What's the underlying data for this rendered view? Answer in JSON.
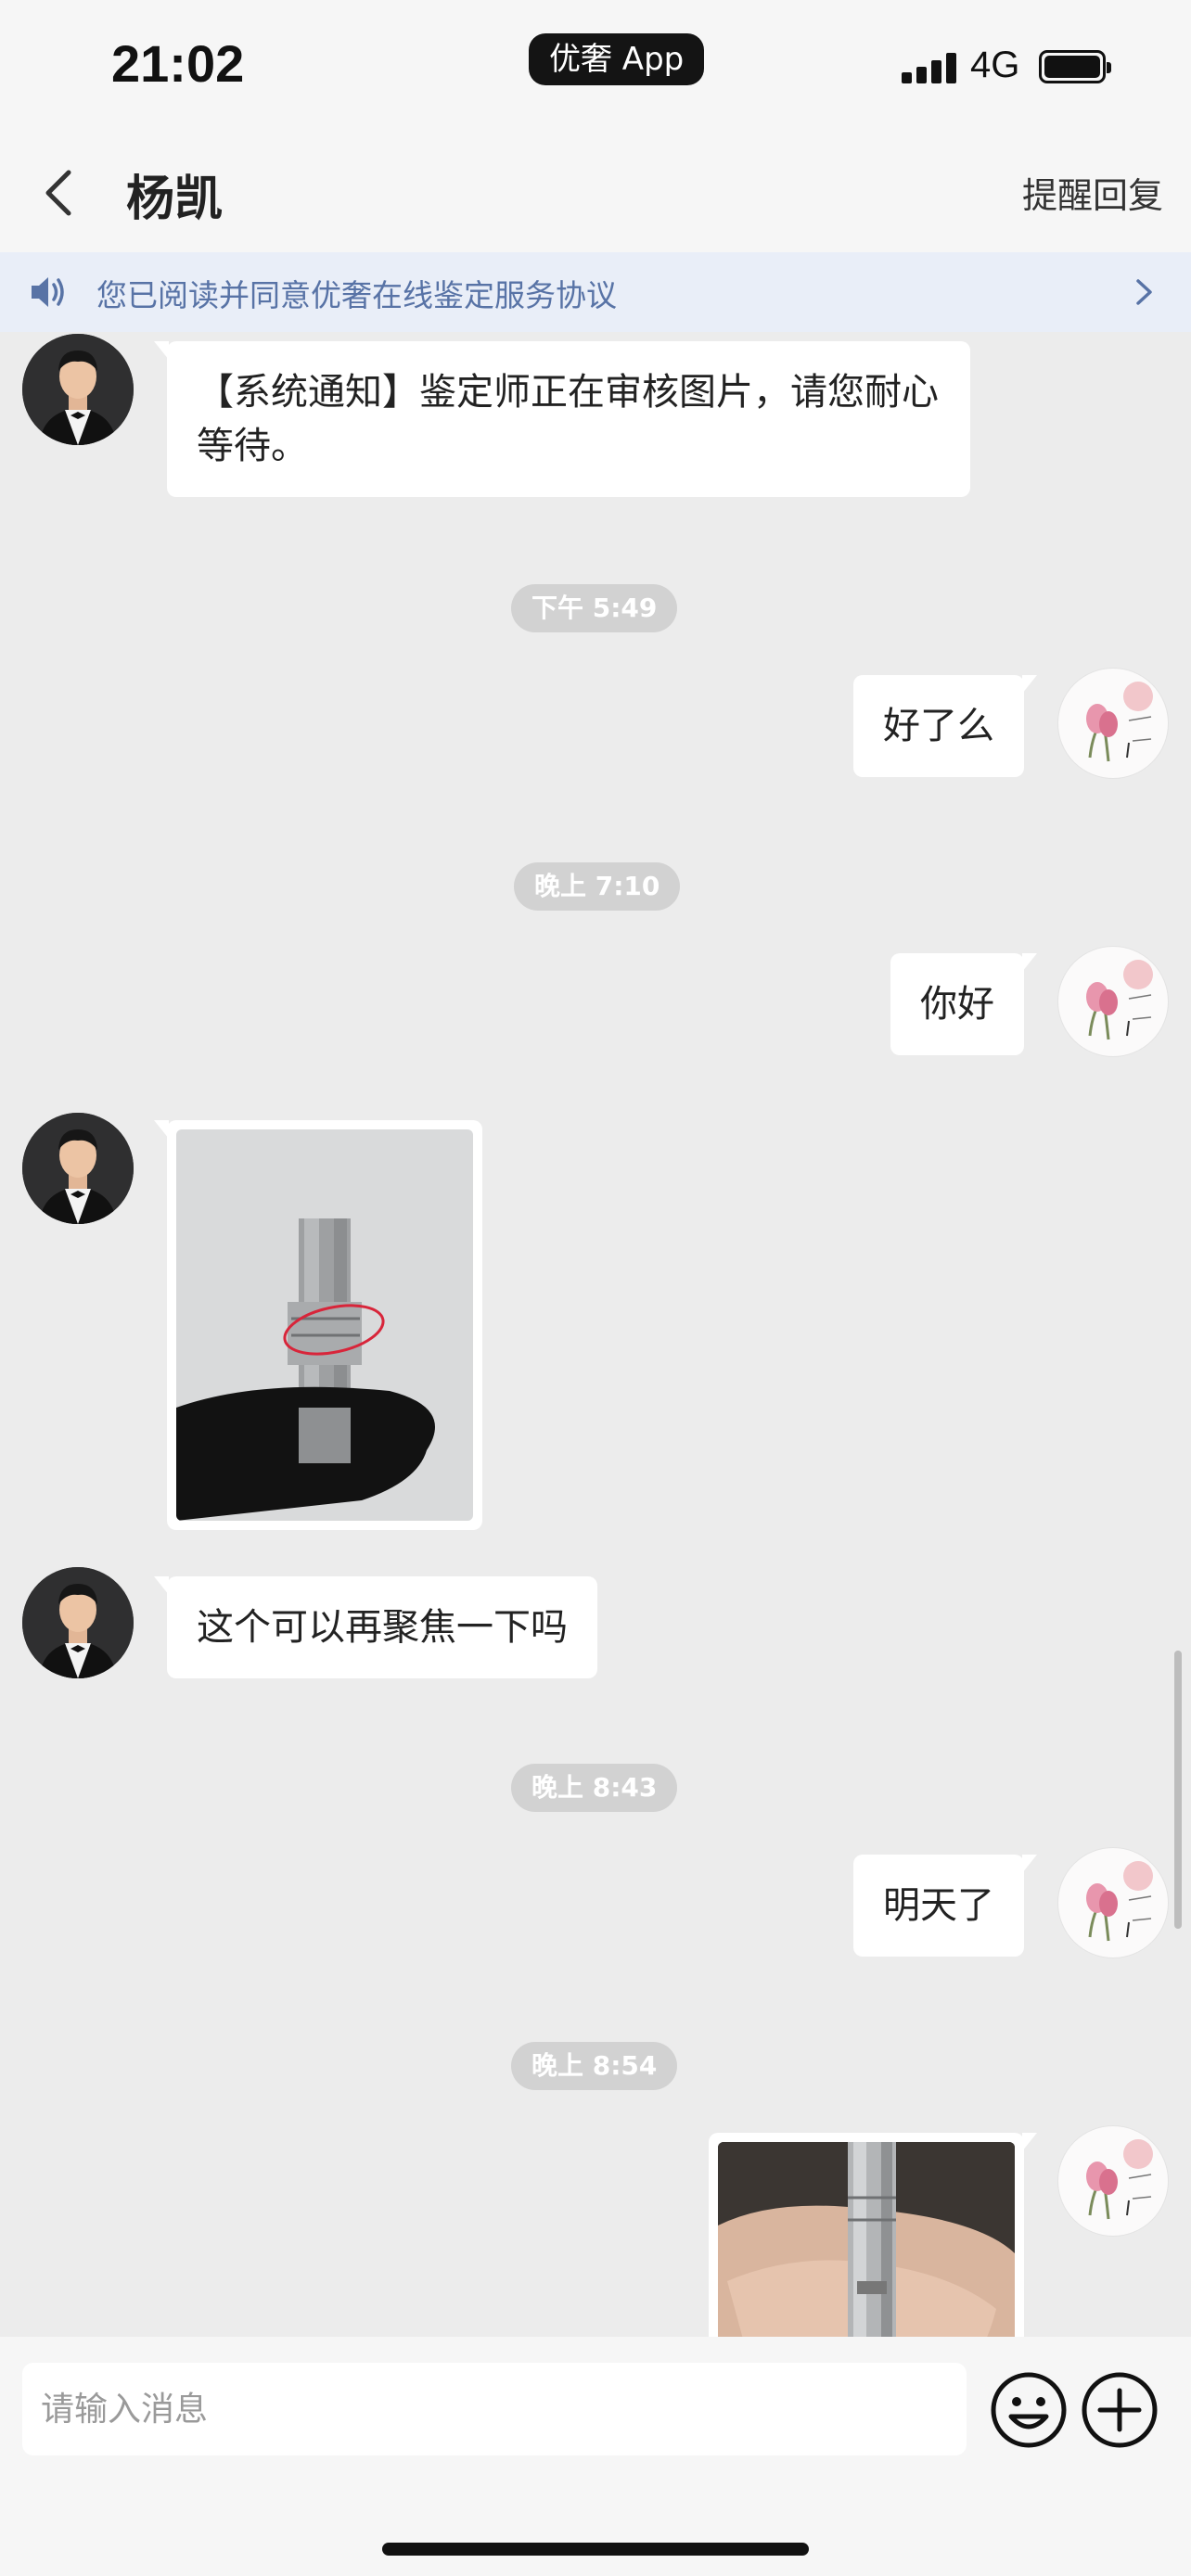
{
  "status_bar": {
    "time": "21:02",
    "app_pill": "优奢 App",
    "network": "4G",
    "signal_bars": 4,
    "battery_level": 1.0
  },
  "header": {
    "title": "杨凯",
    "back_icon": "chevron-left-icon",
    "remind_label": "提醒回复"
  },
  "notice": {
    "icon": "speaker-icon",
    "text": "您已阅读并同意优奢在线鉴定服务协议",
    "chevron": "chevron-right-icon"
  },
  "messages": [
    {
      "side": "left",
      "type": "text",
      "text": "【系统通知】鉴定师正在审核图片，请您耐心等待。"
    },
    {
      "type": "time",
      "text": "下午 5:49"
    },
    {
      "side": "right",
      "type": "text",
      "text": "好了么"
    },
    {
      "type": "time",
      "text": "晚上 7:10"
    },
    {
      "side": "right",
      "type": "text",
      "text": "你好"
    },
    {
      "side": "left",
      "type": "image",
      "subject": "watch-clasp-photo-circled"
    },
    {
      "side": "left",
      "type": "text",
      "text": "这个可以再聚焦一下吗"
    },
    {
      "type": "time",
      "text": "晚上 8:43"
    },
    {
      "side": "right",
      "type": "text",
      "text": "明天了"
    },
    {
      "type": "time",
      "text": "晚上 8:54"
    },
    {
      "side": "right",
      "type": "image",
      "subject": "watch-clasp-hand-photo"
    }
  ],
  "input": {
    "placeholder": "请输入消息",
    "emoji_icon": "emoji-icon",
    "plus_icon": "plus-icon"
  },
  "colors": {
    "background": "#ececec",
    "bubble": "#ffffff",
    "notice_bg": "#e9eef8",
    "notice_text": "#5873a6",
    "time_badge": "#d2d2d2"
  }
}
